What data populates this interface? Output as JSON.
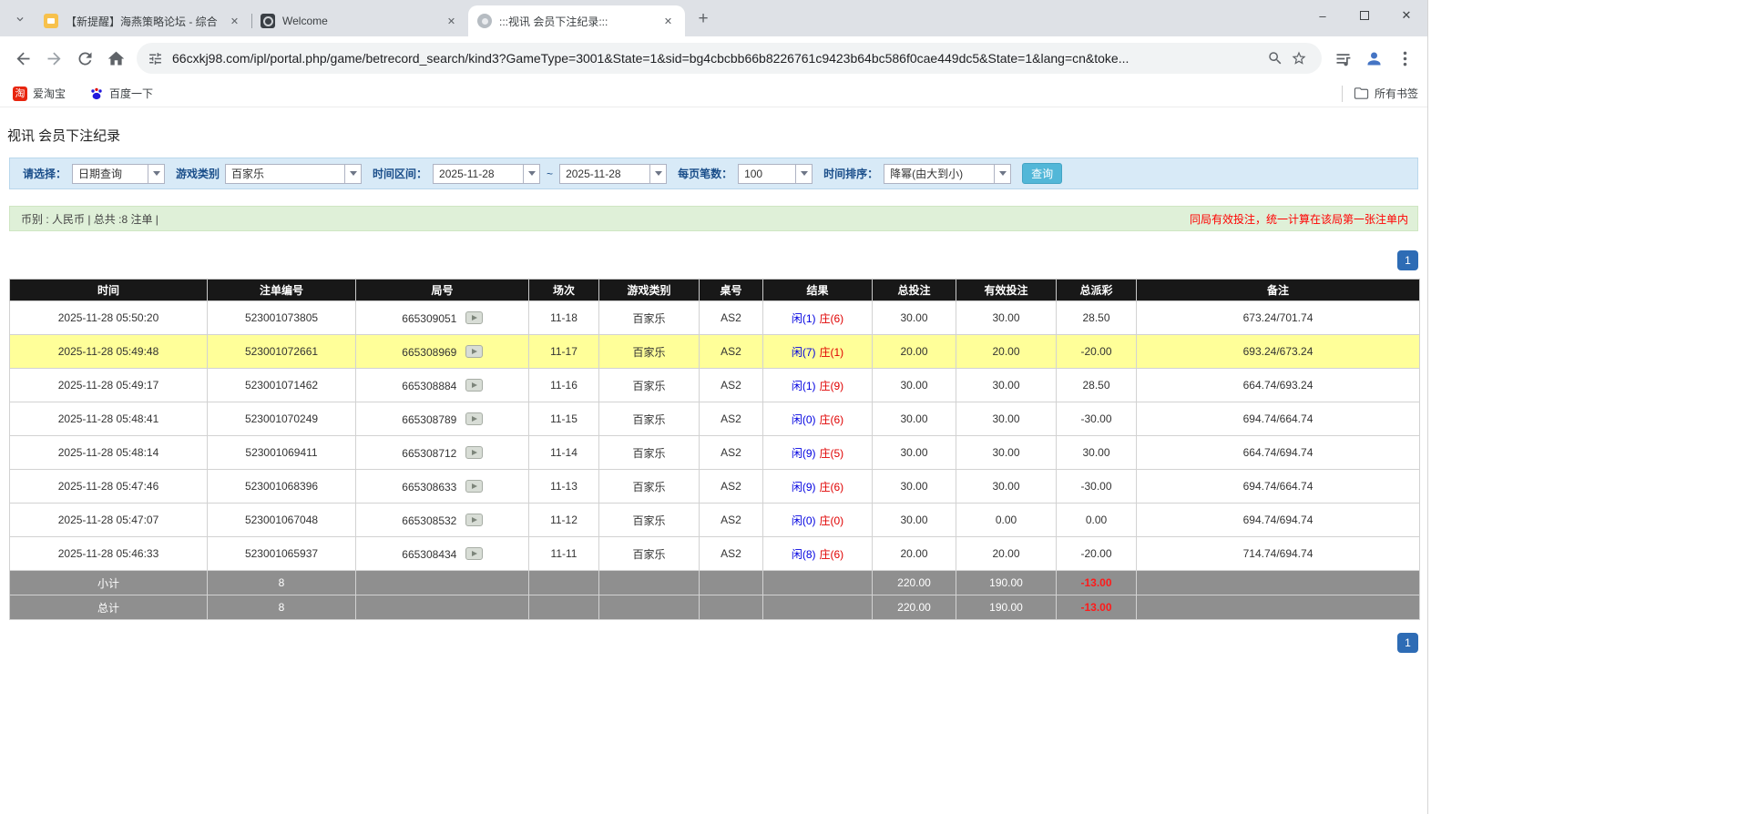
{
  "browser": {
    "tabs": [
      {
        "title": "【新提醒】海燕策略论坛 - 综合",
        "active": false
      },
      {
        "title": "Welcome",
        "active": false
      },
      {
        "title": ":::视讯 会员下注纪录:::",
        "active": true
      }
    ],
    "new_tab": "+",
    "window_controls": {
      "minimize": "–",
      "close": "✕"
    },
    "url": "66cxkj98.com/ipl/portal.php/game/betrecord_search/kind3?GameType=3001&State=1&sid=bg4cbcbb66b8226761c9423b64bc586f0cae449dc5&State=1&lang=cn&toke...",
    "bookmarks": [
      {
        "label": "爱淘宝",
        "icon": "taobao-icon",
        "icon_glyph": "淘"
      },
      {
        "label": "百度一下",
        "icon": "baidu-paw-icon"
      }
    ],
    "all_bookmarks_label": "所有书签"
  },
  "page": {
    "title": "视讯 会员下注纪录",
    "filter": {
      "select_label": "请选择：",
      "select_value": "日期查询",
      "game_label": "游戏类别",
      "game_value": "百家乐",
      "range_label": "时间区间：",
      "date_from": "2025-11-28",
      "range_sep": "~",
      "date_to": "2025-11-28",
      "per_page_label": "每页笔数：",
      "per_page_value": "100",
      "sort_label": "时间排序：",
      "sort_value": "降幂(由大到小)",
      "search_label": "查询"
    },
    "info": {
      "left": "币别 : 人民币 | 总共 :8 注单 |",
      "right": "同局有效投注，统一计算在该局第一张注单内"
    },
    "pagination": "1",
    "colors": {
      "accent_blue": "#2e6cb5",
      "query_button": "#52b7d8",
      "highlight_row": "#ffff99",
      "header_bg": "#181818",
      "footer_bg": "#8f8f8f",
      "link_blue": "#0b66c3",
      "player_blue": "#0000e0",
      "banker_red": "#e00000",
      "negative_red": "#ff0000",
      "filter_bg": "#d8eaf7",
      "info_bg": "#dff0d8"
    },
    "table": {
      "headers": [
        "时间",
        "注单编号",
        "局号",
        "场次",
        "游戏类别",
        "桌号",
        "结果",
        "总投注",
        "有效投注",
        "总派彩",
        "备注"
      ],
      "rows": [
        {
          "time": "2025-11-28 05:50:20",
          "bet_id": "523001073805",
          "round_id": "665309051",
          "session": "11-18",
          "game": "百家乐",
          "table": "AS2",
          "player": "闲(1)",
          "banker": "庄(6)",
          "total_bet": "30.00",
          "valid_bet": "30.00",
          "payout": "28.50",
          "note": "673.24/701.74",
          "highlight": false
        },
        {
          "time": "2025-11-28 05:49:48",
          "bet_id": "523001072661",
          "round_id": "665308969",
          "session": "11-17",
          "game": "百家乐",
          "table": "AS2",
          "player": "闲(7)",
          "banker": "庄(1)",
          "total_bet": "20.00",
          "valid_bet": "20.00",
          "payout": "-20.00",
          "note": "693.24/673.24",
          "highlight": true
        },
        {
          "time": "2025-11-28 05:49:17",
          "bet_id": "523001071462",
          "round_id": "665308884",
          "session": "11-16",
          "game": "百家乐",
          "table": "AS2",
          "player": "闲(1)",
          "banker": "庄(9)",
          "total_bet": "30.00",
          "valid_bet": "30.00",
          "payout": "28.50",
          "note": "664.74/693.24",
          "highlight": false
        },
        {
          "time": "2025-11-28 05:48:41",
          "bet_id": "523001070249",
          "round_id": "665308789",
          "session": "11-15",
          "game": "百家乐",
          "table": "AS2",
          "player": "闲(0)",
          "banker": "庄(6)",
          "total_bet": "30.00",
          "valid_bet": "30.00",
          "payout": "-30.00",
          "note": "694.74/664.74",
          "highlight": false
        },
        {
          "time": "2025-11-28 05:48:14",
          "bet_id": "523001069411",
          "round_id": "665308712",
          "session": "11-14",
          "game": "百家乐",
          "table": "AS2",
          "player": "闲(9)",
          "banker": "庄(5)",
          "total_bet": "30.00",
          "valid_bet": "30.00",
          "payout": "30.00",
          "note": "664.74/694.74",
          "highlight": false
        },
        {
          "time": "2025-11-28 05:47:46",
          "bet_id": "523001068396",
          "round_id": "665308633",
          "session": "11-13",
          "game": "百家乐",
          "table": "AS2",
          "player": "闲(9)",
          "banker": "庄(6)",
          "total_bet": "30.00",
          "valid_bet": "30.00",
          "payout": "-30.00",
          "note": "694.74/664.74",
          "highlight": false
        },
        {
          "time": "2025-11-28 05:47:07",
          "bet_id": "523001067048",
          "round_id": "665308532",
          "session": "11-12",
          "game": "百家乐",
          "table": "AS2",
          "player": "闲(0)",
          "banker": "庄(0)",
          "total_bet": "30.00",
          "valid_bet": "0.00",
          "payout": "0.00",
          "note": "694.74/694.74",
          "highlight": false
        },
        {
          "time": "2025-11-28 05:46:33",
          "bet_id": "523001065937",
          "round_id": "665308434",
          "session": "11-11",
          "game": "百家乐",
          "table": "AS2",
          "player": "闲(8)",
          "banker": "庄(6)",
          "total_bet": "20.00",
          "valid_bet": "20.00",
          "payout": "-20.00",
          "note": "714.74/694.74",
          "highlight": false
        }
      ],
      "subtotal": {
        "label": "小计",
        "count": "8",
        "total_bet": "220.00",
        "valid_bet": "190.00",
        "payout": "-13.00"
      },
      "total": {
        "label": "总计",
        "count": "8",
        "total_bet": "220.00",
        "valid_bet": "190.00",
        "payout": "-13.00"
      }
    }
  }
}
